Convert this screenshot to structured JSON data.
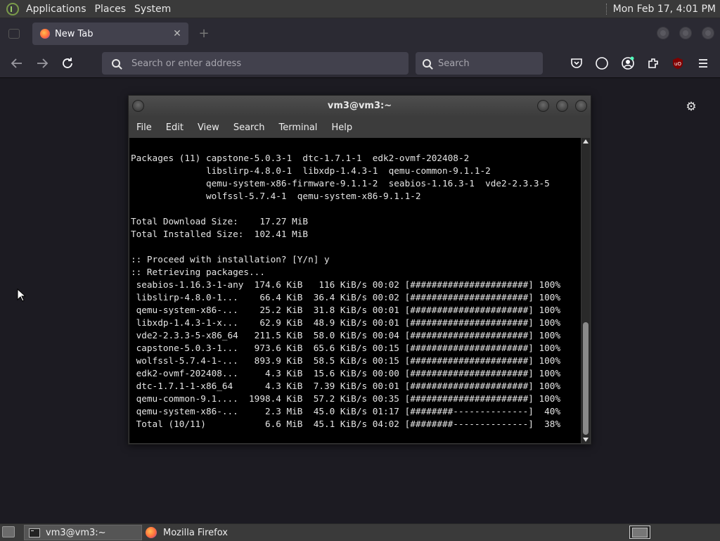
{
  "top_panel": {
    "menus": [
      "Applications",
      "Places",
      "System"
    ],
    "clock": "Mon Feb 17,  4:01 PM"
  },
  "browser": {
    "tab": {
      "title": "New Tab",
      "close": "✕"
    },
    "new_tab": "+",
    "url_placeholder": "Search or enter address",
    "search_placeholder": "Search"
  },
  "terminal": {
    "title": "vm3@vm3:~",
    "menus": [
      "File",
      "Edit",
      "View",
      "Search",
      "Terminal",
      "Help"
    ],
    "lines": [
      "Packages (11) capstone-5.0.3-1  dtc-1.7.1-1  edk2-ovmf-202408-2",
      "              libslirp-4.8.0-1  libxdp-1.4.3-1  qemu-common-9.1.1-2",
      "              qemu-system-x86-firmware-9.1.1-2  seabios-1.16.3-1  vde2-2.3.3-5",
      "              wolfssl-5.7.4-1  qemu-system-x86-9.1.1-2",
      "",
      "Total Download Size:    17.27 MiB",
      "Total Installed Size:  102.41 MiB",
      "",
      ":: Proceed with installation? [Y/n] y",
      ":: Retrieving packages...",
      " seabios-1.16.3-1-any  174.6 KiB   116 KiB/s 00:02 [######################] 100%",
      " libslirp-4.8.0-1...    66.4 KiB  36.4 KiB/s 00:02 [######################] 100%",
      " qemu-system-x86-...    25.2 KiB  31.8 KiB/s 00:01 [######################] 100%",
      " libxdp-1.4.3-1-x...    62.9 KiB  48.9 KiB/s 00:01 [######################] 100%",
      " vde2-2.3.3-5-x86_64   211.5 KiB  58.0 KiB/s 00:04 [######################] 100%",
      " capstone-5.0.3-1...   973.6 KiB  65.6 KiB/s 00:15 [######################] 100%",
      " wolfssl-5.7.4-1-...   893.9 KiB  58.5 KiB/s 00:15 [######################] 100%",
      " edk2-ovmf-202408...     4.3 KiB  15.6 KiB/s 00:00 [######################] 100%",
      " dtc-1.7.1-1-x86_64      4.3 KiB  7.39 KiB/s 00:01 [######################] 100%",
      " qemu-common-9.1....  1998.4 KiB  57.2 KiB/s 00:35 [######################] 100%",
      " qemu-system-x86-...     2.3 MiB  45.0 KiB/s 01:17 [########--------------]  40%",
      " Total (10/11)           6.6 MiB  45.1 KiB/s 04:02 [########--------------]  38%"
    ]
  },
  "taskbar": {
    "items": [
      "vm3@vm3:~",
      "Mozilla Firefox"
    ]
  },
  "colors": {
    "panel": "#3a3a3a",
    "browser_chrome": "#2b2a33",
    "page_bg": "#1c1b22",
    "terminal_bg": "#000000"
  }
}
